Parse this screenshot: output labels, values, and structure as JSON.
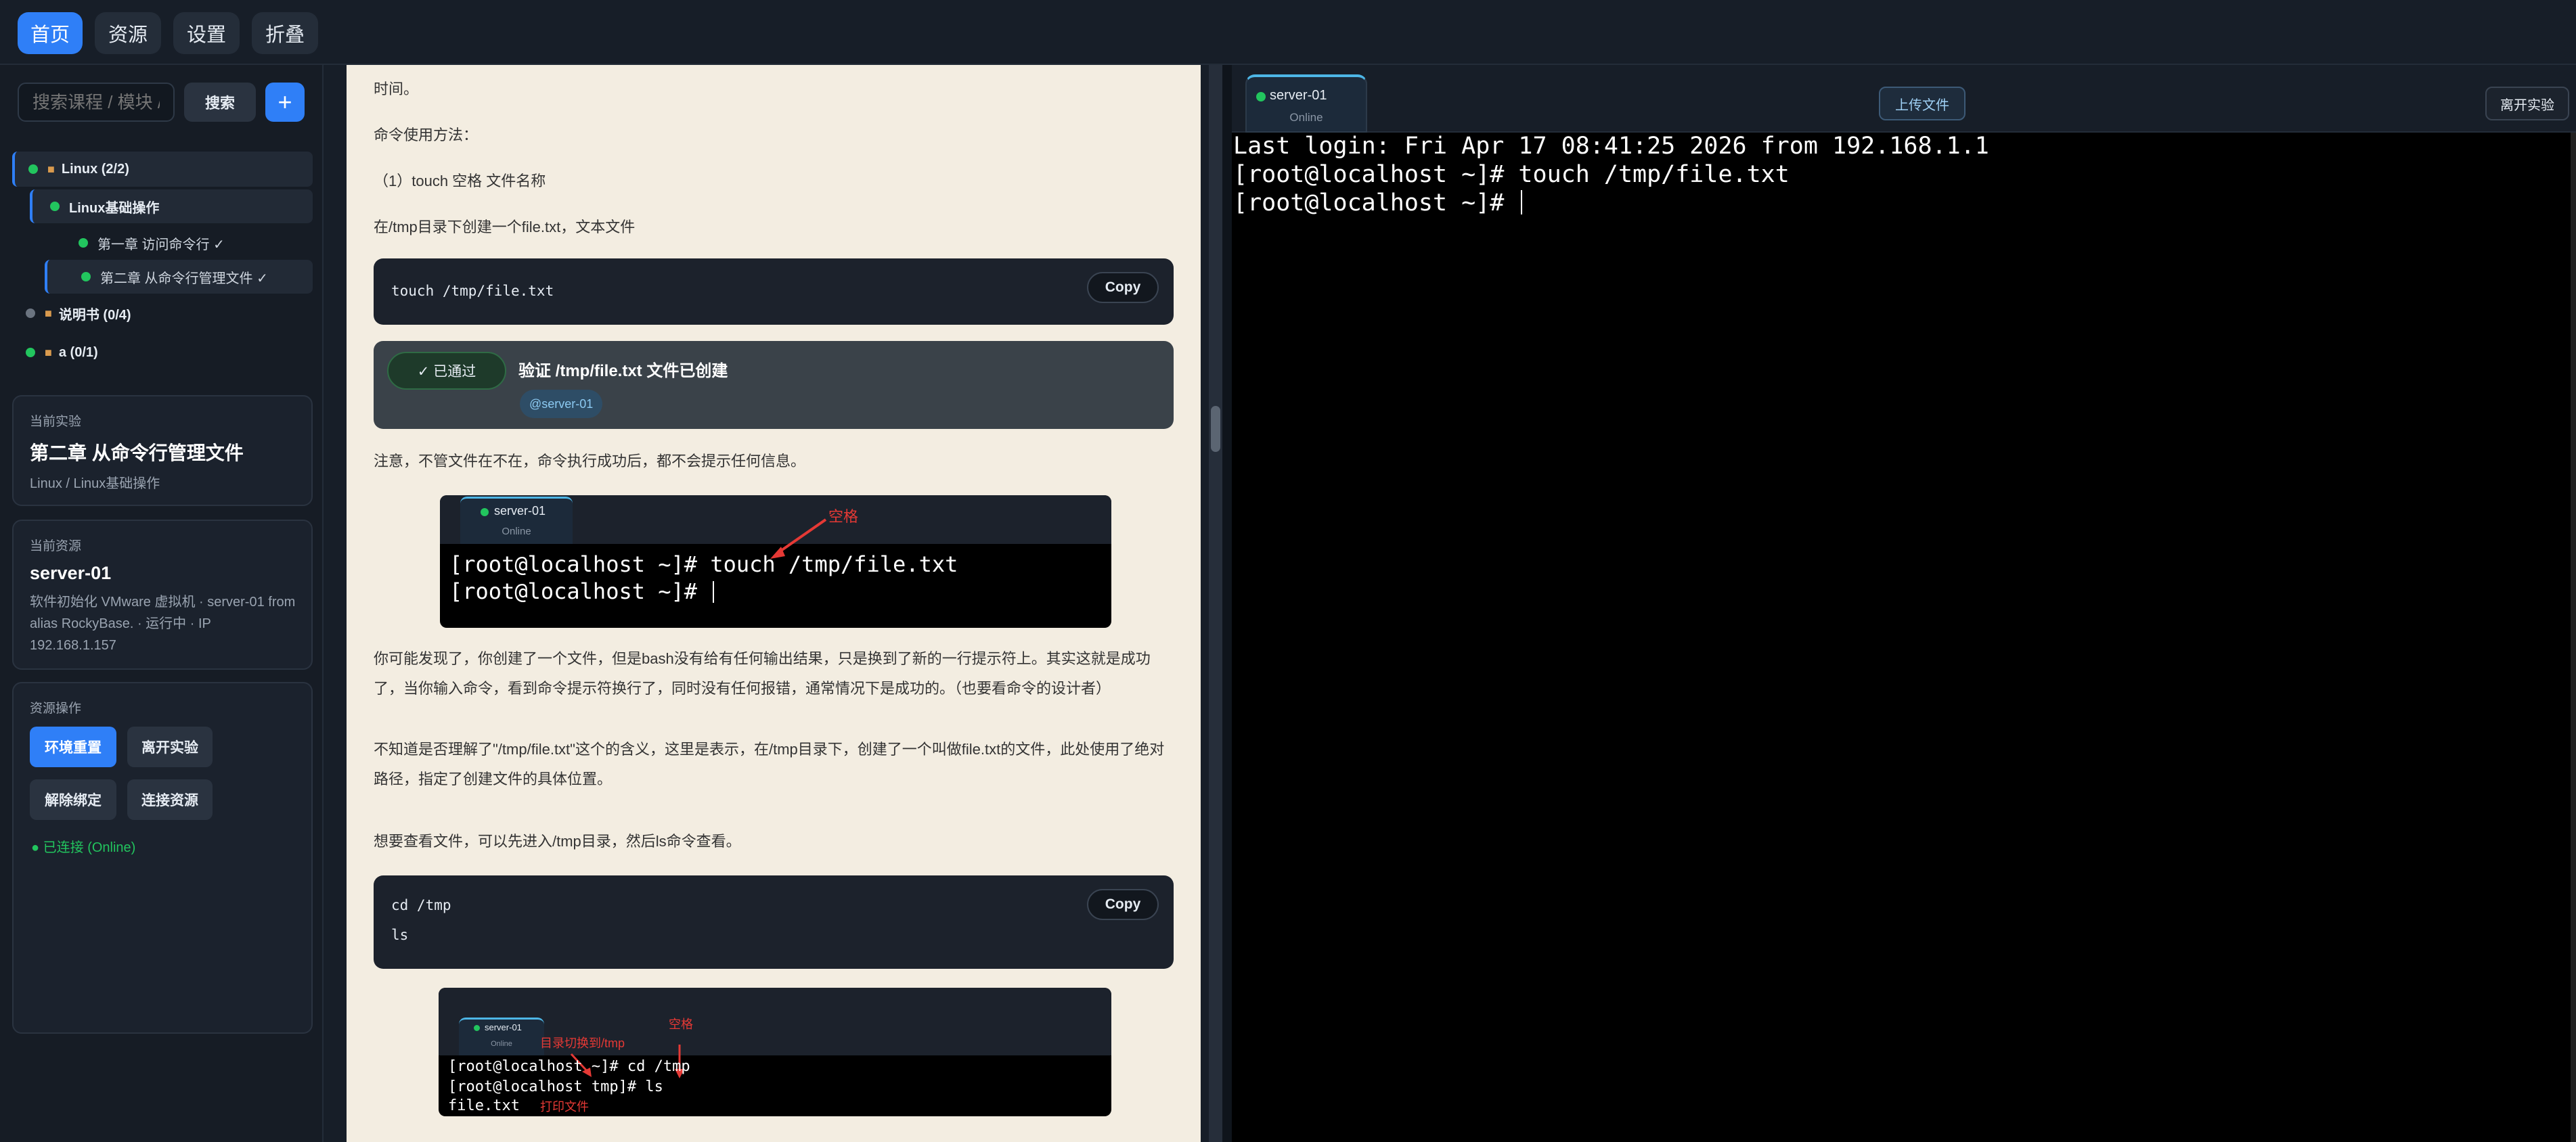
{
  "nav": {
    "items": [
      {
        "label": "首页",
        "active": true
      },
      {
        "label": "资源",
        "active": false
      },
      {
        "label": "设置",
        "active": false
      },
      {
        "label": "折叠",
        "active": false
      }
    ]
  },
  "sidebar": {
    "search_placeholder": "搜索课程 / 模块 / 章节",
    "search_button": "搜索",
    "add_button": "+",
    "tree": {
      "course1": "Linux (2/2)",
      "module1": "Linux基础操作",
      "chapter1": "第一章 访问命令行 ✓",
      "chapter2": "第二章 从命令行管理文件 ✓",
      "course2": "说明书 (0/4)",
      "course3": "a (0/1)"
    },
    "current_lab": {
      "label": "当前实验",
      "title": "第二章 从命令行管理文件",
      "path": "Linux / Linux基础操作"
    },
    "current_resource": {
      "label": "当前资源",
      "name": "server-01",
      "desc": "软件初始化 VMware 虚拟机 · server-01 from alias RockyBase. · 运行中 · IP 192.168.1.157"
    },
    "resource_ops": {
      "label": "资源操作",
      "reset": "环境重置",
      "leave": "离开实验",
      "unbind": "解除绑定",
      "connect": "连接资源",
      "status": "● 已连接 (Online)"
    }
  },
  "doc": {
    "p_time": "时间。",
    "p_usage": "命令使用方法：",
    "p_syntax": "（1）touch 空格 文件名称",
    "p_create": "在/tmp目录下创建一个file.txt，文本文件",
    "code1": "touch /tmp/file.txt",
    "copy_label": "Copy",
    "verify_pass": "✓  已通过",
    "verify_title": "验证 /tmp/file.txt 文件已创建",
    "verify_tag": "@server-01",
    "p_note": "注意，不管文件在不在，命令执行成功后，都不会提示任何信息。",
    "img1": {
      "tab": "server-01",
      "status": "Online",
      "annot": "空格",
      "line1": "[root@localhost ~]# touch /tmp/file.txt",
      "line2": "[root@localhost ~]# "
    },
    "p_discover": "你可能发现了，你创建了一个文件，但是bash没有给有任何输出结果，只是换到了新的一行提示符上。其实这就是成功了，当你输入命令，看到命令提示符换行了，同时没有任何报错，通常情况下是成功的。（也要看命令的设计者）",
    "p_explain": "不知道是否理解了\"/tmp/file.txt\"这个的含义，这里是表示，在/tmp目录下，创建了一个叫做file.txt的文件，此处使用了绝对路径，指定了创建文件的具体位置。",
    "p_view": "想要查看文件，可以先进入/tmp目录，然后ls命令查看。",
    "code2_line1": "cd /tmp",
    "code2_line2": "ls",
    "img2": {
      "tab": "server-01",
      "status": "Online",
      "annot_dir": "目录切换到/tmp",
      "annot_space": "空格",
      "annot_print": "打印文件",
      "line1": "[root@localhost ~]# cd /tmp",
      "line2": "[root@localhost tmp]# ls",
      "line3": "file.txt"
    }
  },
  "terminal": {
    "tab_name": "server-01",
    "tab_status": "Online",
    "upload_button": "上传文件",
    "leave_button": "离开实验",
    "lines": [
      "Last login: Fri Apr 17 08:41:25 2026 from 192.168.1.1",
      "[root@localhost ~]# touch /tmp/file.txt",
      "[root@localhost ~]# "
    ]
  },
  "colors": {
    "accent": "#2f7ff7",
    "online": "#22c55e",
    "doc_bg": "#f3ede1",
    "annotation": "#e53935"
  }
}
